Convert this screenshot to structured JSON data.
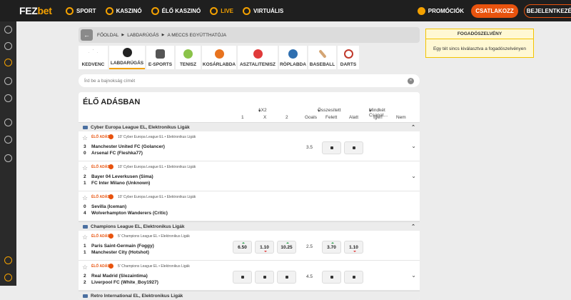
{
  "brand": {
    "name_part1": "FEZ",
    "name_part2": "bet"
  },
  "nav": [
    {
      "label": "SPORT",
      "icon": "soccer-icon"
    },
    {
      "label": "KASZINÓ",
      "icon": "casino-icon"
    },
    {
      "label": "ÉLŐ KASZINÓ",
      "icon": "live-casino-icon"
    },
    {
      "label": "LIVE",
      "icon": "live-icon"
    },
    {
      "label": "VIRTUÁLIS",
      "icon": "virtual-icon"
    }
  ],
  "top_right": {
    "promo": "PROMÓCIÓK",
    "join": "CSATLAKOZZ",
    "login": "BEJELENTKEZÉS"
  },
  "breadcrumb": [
    "FŐOLDAL",
    "LABDARÚGÁS",
    "A MECCS EGYÜTTHATÓJA"
  ],
  "sports": [
    {
      "label": "KEDVENC",
      "color": "#ffffff"
    },
    {
      "label": "LABDARÚGÁS",
      "color": "#222222"
    },
    {
      "label": "E-SPORTS",
      "color": "#555555"
    },
    {
      "label": "TENISZ",
      "color": "#8bc34a"
    },
    {
      "label": "KOSÁRLABDA",
      "color": "#e8731e"
    },
    {
      "label": "ASZTALITENISZ",
      "color": "#e03a3a"
    },
    {
      "label": "RÖPLABDA",
      "color": "#2f6fb0"
    },
    {
      "label": "BASEBALL",
      "color": "#d4a574"
    },
    {
      "label": "DARTS",
      "color": "#c0392b"
    }
  ],
  "search_placeholder": "Írd be a bajnokság címét",
  "live_title": "ÉLŐ ADÁSBAN",
  "columns": {
    "group1": "1X2",
    "group2": "Összesített",
    "group3": "Mindkét Csapat...",
    "c1": "1",
    "cx": "X",
    "c2": "2",
    "goals": "Goals",
    "over": "Felett",
    "under": "Alatt",
    "yes": "Igen",
    "no": "Nem"
  },
  "leagues": [
    {
      "name": "Cyber Europa League EL, Elektronikus Ligák",
      "matches": [
        {
          "live": "ÉLŐ ADÁS",
          "minute": "10'",
          "meta": "Cyber Europa League EL • Elektronikus Ligák",
          "home_score": "3",
          "home": "Manchester United FC (Golancer)",
          "away_score": "0",
          "away": "Arsenal FC (Fleshka77)",
          "goals": "3.5",
          "odds": null
        },
        {
          "live": "ÉLŐ ADÁS",
          "minute": "10'",
          "meta": "Cyber Europa League EL • Elektronikus Ligák",
          "home_score": "2",
          "home": "Bayer 04 Leverkusen (Sima)",
          "away_score": "1",
          "away": "FC Inter Milano (Unknown)",
          "goals": "",
          "odds": null
        },
        {
          "live": "ÉLŐ ADÁS",
          "minute": "10'",
          "meta": "Cyber Europa League EL • Elektronikus Ligák",
          "home_score": "0",
          "home": "Sevilla (Iceman)",
          "away_score": "4",
          "away": "Wolverhampton Wanderers (Critic)",
          "goals": "",
          "odds": null
        }
      ]
    },
    {
      "name": "Champions League EL, Elektronikus Ligák",
      "matches": [
        {
          "live": "ÉLŐ ADÁS",
          "minute": "5'",
          "meta": "Champions League EL • Elektronikus Ligák",
          "home_score": "1",
          "home": "Paris Saint-Germain (Foggy)",
          "away_score": "1",
          "away": "Manchester City (Hotshot)",
          "goals": "2.5",
          "odds": {
            "o1": "6.50",
            "ox": "1.10",
            "o2": "10.25",
            "over": "3.70",
            "under": "1.10"
          }
        },
        {
          "live": "ÉLŐ ADÁS",
          "minute": "5'",
          "meta": "Champions League EL • Elektronikus Ligák",
          "home_score": "2",
          "home": "Real Madrid (Slezaintima)",
          "away_score": "2",
          "away": "Liverpool FC (White_Boy1927)",
          "goals": "4.5",
          "odds": null
        }
      ]
    },
    {
      "name": "Retro International EL, Elektronikus Ligák",
      "matches": []
    }
  ],
  "betslip": {
    "title": "FOGADÓSZELVÉNY",
    "empty": "Egy tét sincs kiválasztva a fogadószelvényen"
  }
}
